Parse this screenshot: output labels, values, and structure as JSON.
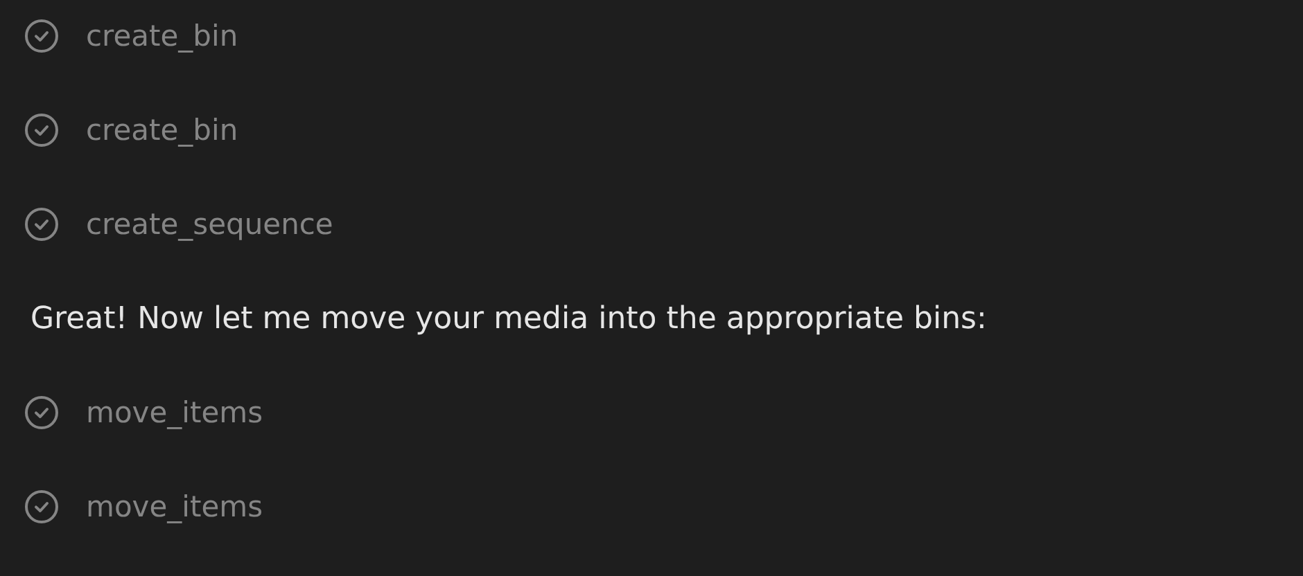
{
  "items": [
    {
      "kind": "tool",
      "label": "create_bin"
    },
    {
      "kind": "tool",
      "label": "create_bin"
    },
    {
      "kind": "tool",
      "label": "create_sequence"
    },
    {
      "kind": "message",
      "text": "Great! Now let me move your media into the appropriate bins:"
    },
    {
      "kind": "tool",
      "label": "move_items"
    },
    {
      "kind": "tool",
      "label": "move_items"
    }
  ]
}
